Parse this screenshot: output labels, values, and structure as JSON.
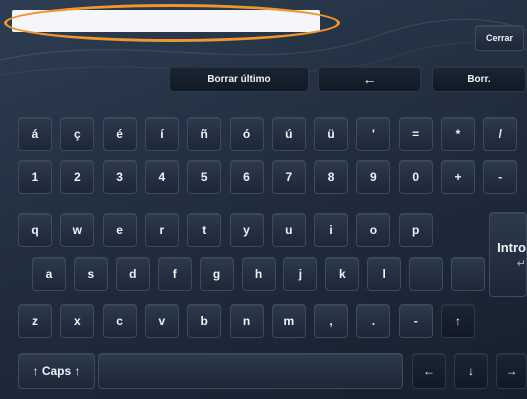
{
  "top_buttons": {
    "close": "Cerrar",
    "delete_last": "Borrar último",
    "back_arrow": "←",
    "clear": "Borr."
  },
  "rows": {
    "accents": [
      "á",
      "ç",
      "é",
      "í",
      "ñ",
      "ó",
      "ú",
      "ü",
      "'",
      "=",
      "*",
      "/"
    ],
    "numbers": [
      "1",
      "2",
      "3",
      "4",
      "5",
      "6",
      "7",
      "8",
      "9",
      "0",
      "+",
      "-"
    ],
    "row_q": [
      "q",
      "w",
      "e",
      "r",
      "t",
      "y",
      "u",
      "i",
      "o",
      "p"
    ],
    "row_a": [
      "a",
      "s",
      "d",
      "f",
      "g",
      "h",
      "j",
      "k",
      "l",
      "",
      ""
    ],
    "row_z": [
      "z",
      "x",
      "c",
      "v",
      "b",
      "n",
      "m",
      ",",
      ".",
      "-",
      "↑"
    ]
  },
  "enter": {
    "label": "Intro",
    "arrow": "↵"
  },
  "bottom": {
    "caps": "↑ Caps ↑",
    "left": "←",
    "down": "↓",
    "right": "→"
  },
  "colors": {
    "highlight": "#f0962a"
  }
}
